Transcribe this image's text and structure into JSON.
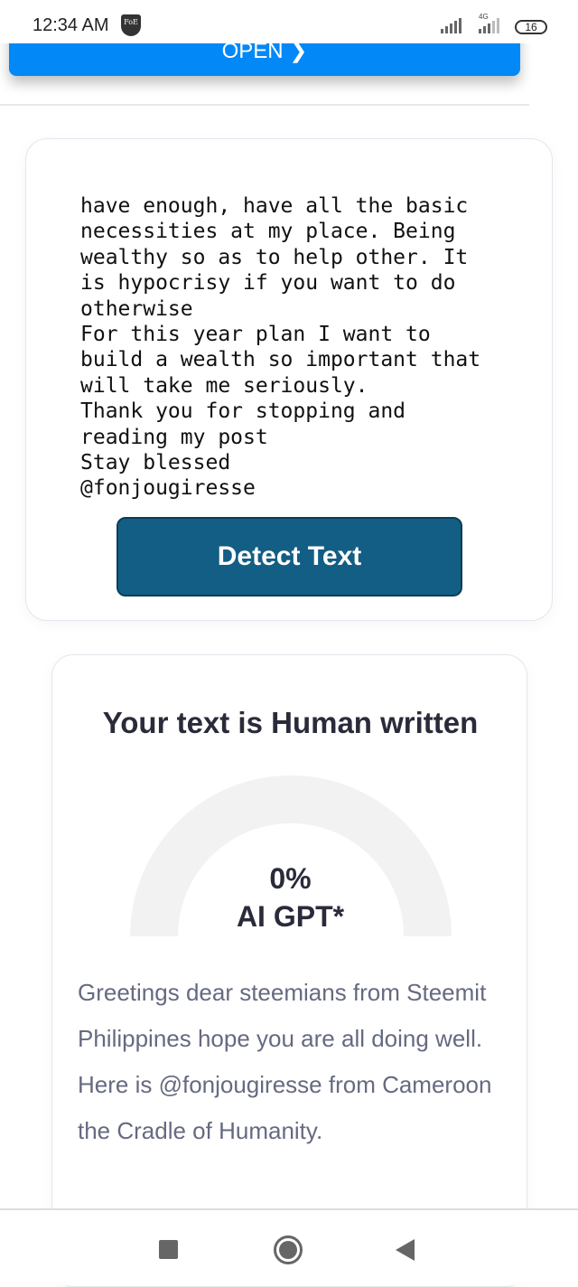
{
  "status_bar": {
    "time": "12:34 AM",
    "app_badge": "FoE",
    "network": "4G",
    "battery": "16"
  },
  "top_button": {
    "label": "OPEN ❯"
  },
  "input_card": {
    "text": "have enough, have all the basic\nnecessities at my place. Being\nwealthy so as to help other. It\nis hypocrisy if you want to do\notherwise\nFor this year plan I want to\nbuild a wealth so important that\nwill take me seriously.\nThank you for stopping and\nreading my post\nStay blessed\n@fonjougiresse",
    "detect_label": "Detect Text"
  },
  "result_card": {
    "title": "Your text is Human written",
    "ai_percent": "0%",
    "ai_label": "AI GPT*",
    "ai_fraction": 0,
    "gauge_color": "#f2f2f2",
    "summary": "Greetings dear steemians from Steemit Philippines hope you are all doing well. Here is @fonjougiresse from Cameroon the Cradle of Humanity."
  },
  "colors": {
    "accent": "#0288f7",
    "detect_button": "#135e84"
  }
}
